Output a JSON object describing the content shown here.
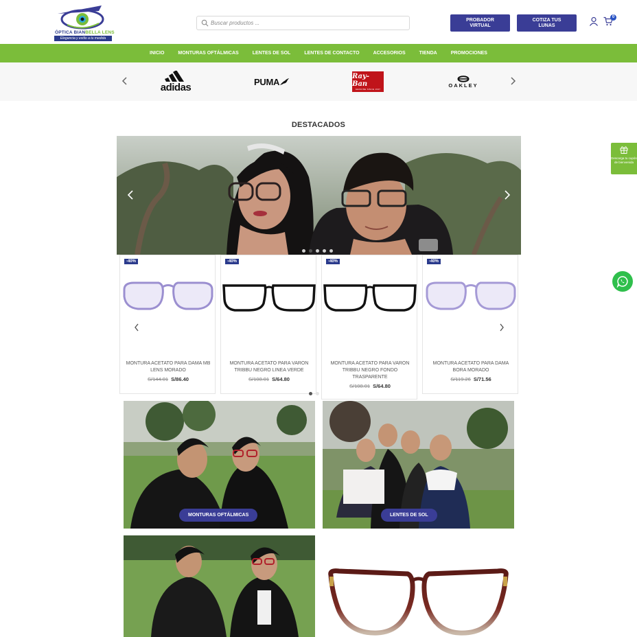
{
  "header": {
    "logo": {
      "name_main": "ÓPTICA BIAN",
      "name_accent": "BELLA LENS",
      "tagline": "Elegancia y estilo a tu medida"
    },
    "search_placeholder": "Buscar productos ...",
    "buttons": [
      {
        "label": "PROBADOR\nVIRTUAL"
      },
      {
        "label": "COTIZA TUS\nLUNAS"
      }
    ],
    "cart_count": "0",
    "icons": {
      "user": "user-icon",
      "cart": "cart-icon",
      "search": "search-icon"
    }
  },
  "nav": {
    "items": [
      "INICIO",
      "MONTURAS OFTÁLMICAS",
      "LENTES DE SOL",
      "LENTES DE CONTACTO",
      "ACCESORIOS",
      "TIENDA",
      "PROMOCIONES"
    ]
  },
  "brands": {
    "items": [
      {
        "name": "adidas"
      },
      {
        "name": "PUMA"
      },
      {
        "name": "Ray-Ban",
        "sub": "GENUINE SINCE 1937"
      },
      {
        "name": "OAKLEY"
      }
    ]
  },
  "featured": {
    "title": "DESTACADOS",
    "hero_slide_count": 5,
    "hero_active_slide": 2
  },
  "products": [
    {
      "badge": "-40%",
      "name": "MONTURA ACETATO PARA DAMA MB LENS MORADO",
      "old_price": "S/144.01",
      "new_price": "S/86.40",
      "frame_color": "#9b8fd0"
    },
    {
      "badge": "-40%",
      "name": "MONTURA ACETATO PARA VARON TRIBBU NEGRO LINEA VERDE",
      "old_price": "S/108.01",
      "new_price": "S/64.80",
      "frame_color": "#111111"
    },
    {
      "badge": "-40%",
      "name": "MONTURA ACETATO PARA VARON TRIBBU NEGRO FONDO TRASPARENTE",
      "old_price": "S/108.01",
      "new_price": "S/64.80",
      "frame_color": "#111111"
    },
    {
      "badge": "-40%",
      "name": "MONTURA ACETATO PARA DAMA BORA MORADO",
      "old_price": "S/119.26",
      "new_price": "S/71.56",
      "frame_color": "#a59ad6"
    }
  ],
  "product_slider": {
    "page_count": 2,
    "active_page": 1
  },
  "categories": [
    {
      "label": "MONTURAS OFTÁLMICAS"
    },
    {
      "label": "LENTES DE SOL"
    }
  ],
  "floating": {
    "gift_text": "Descarga tu cupón de bienvenida",
    "whatsapp_icon": "whatsapp-icon"
  },
  "colors": {
    "primary": "#3a3d96",
    "accent_green": "#7bbd3a",
    "whatsapp": "#2fbf4c",
    "rayban_red": "#c0141a"
  }
}
